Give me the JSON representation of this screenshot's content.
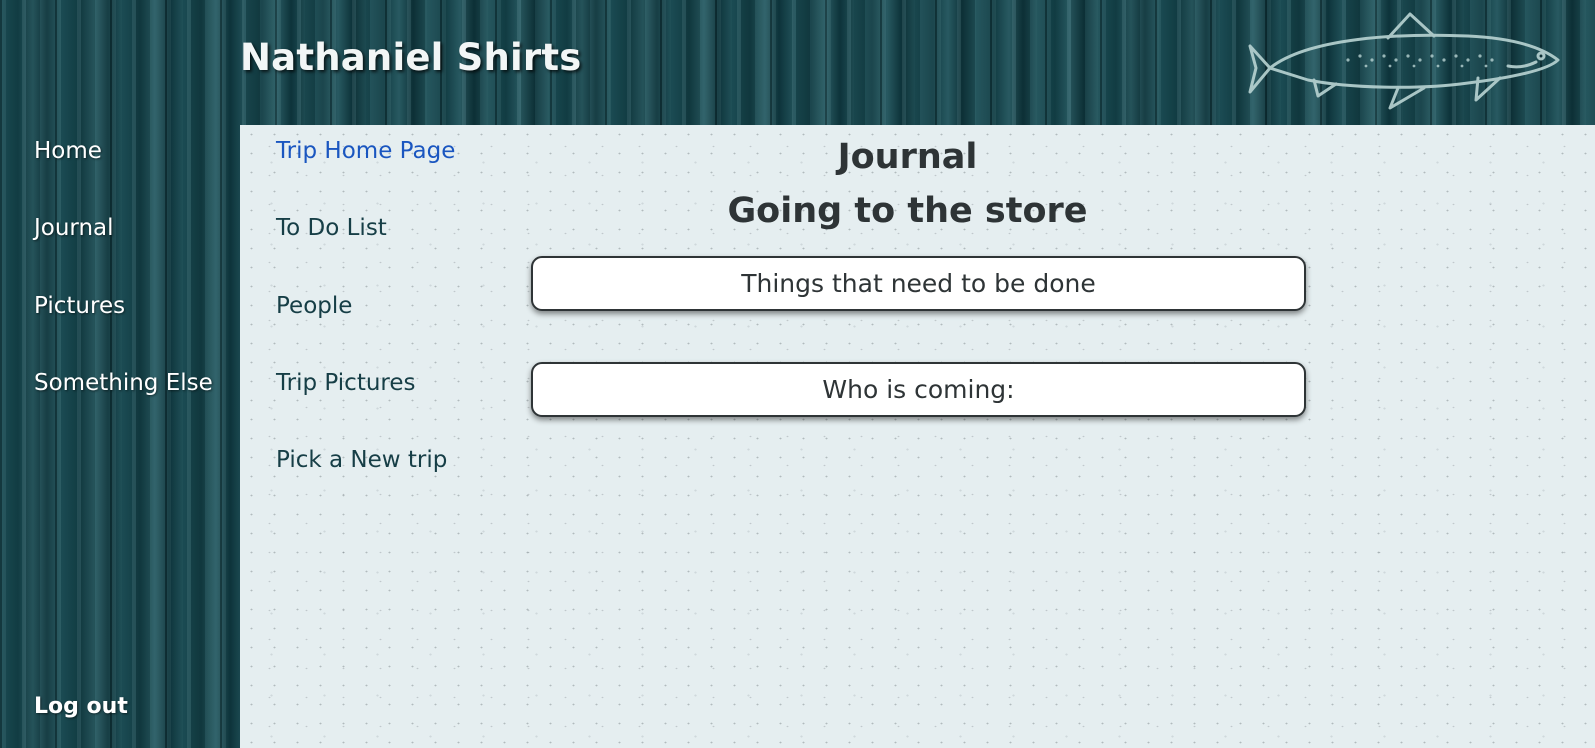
{
  "header": {
    "title": "Nathaniel Shirts",
    "logo_icon": "fish-icon"
  },
  "left_nav": {
    "items": [
      {
        "label": "Home"
      },
      {
        "label": "Journal"
      },
      {
        "label": "Pictures"
      },
      {
        "label": "Something Else"
      }
    ],
    "logout_label": "Log out"
  },
  "trip_nav": {
    "items": [
      {
        "label": "Trip Home Page",
        "active": true
      },
      {
        "label": "To Do List"
      },
      {
        "label": "People"
      },
      {
        "label": "Trip Pictures"
      },
      {
        "label": "Pick a New trip"
      }
    ]
  },
  "main": {
    "heading": "Journal",
    "trip_name": "Going to the store",
    "cards": [
      {
        "label": "Things that need to be done"
      },
      {
        "label": "Who is coming:"
      }
    ]
  },
  "colors": {
    "sidebar": "#174950",
    "panel": "#e5eef0",
    "active_link": "#1a56c0",
    "text_dark": "#2e3436"
  }
}
